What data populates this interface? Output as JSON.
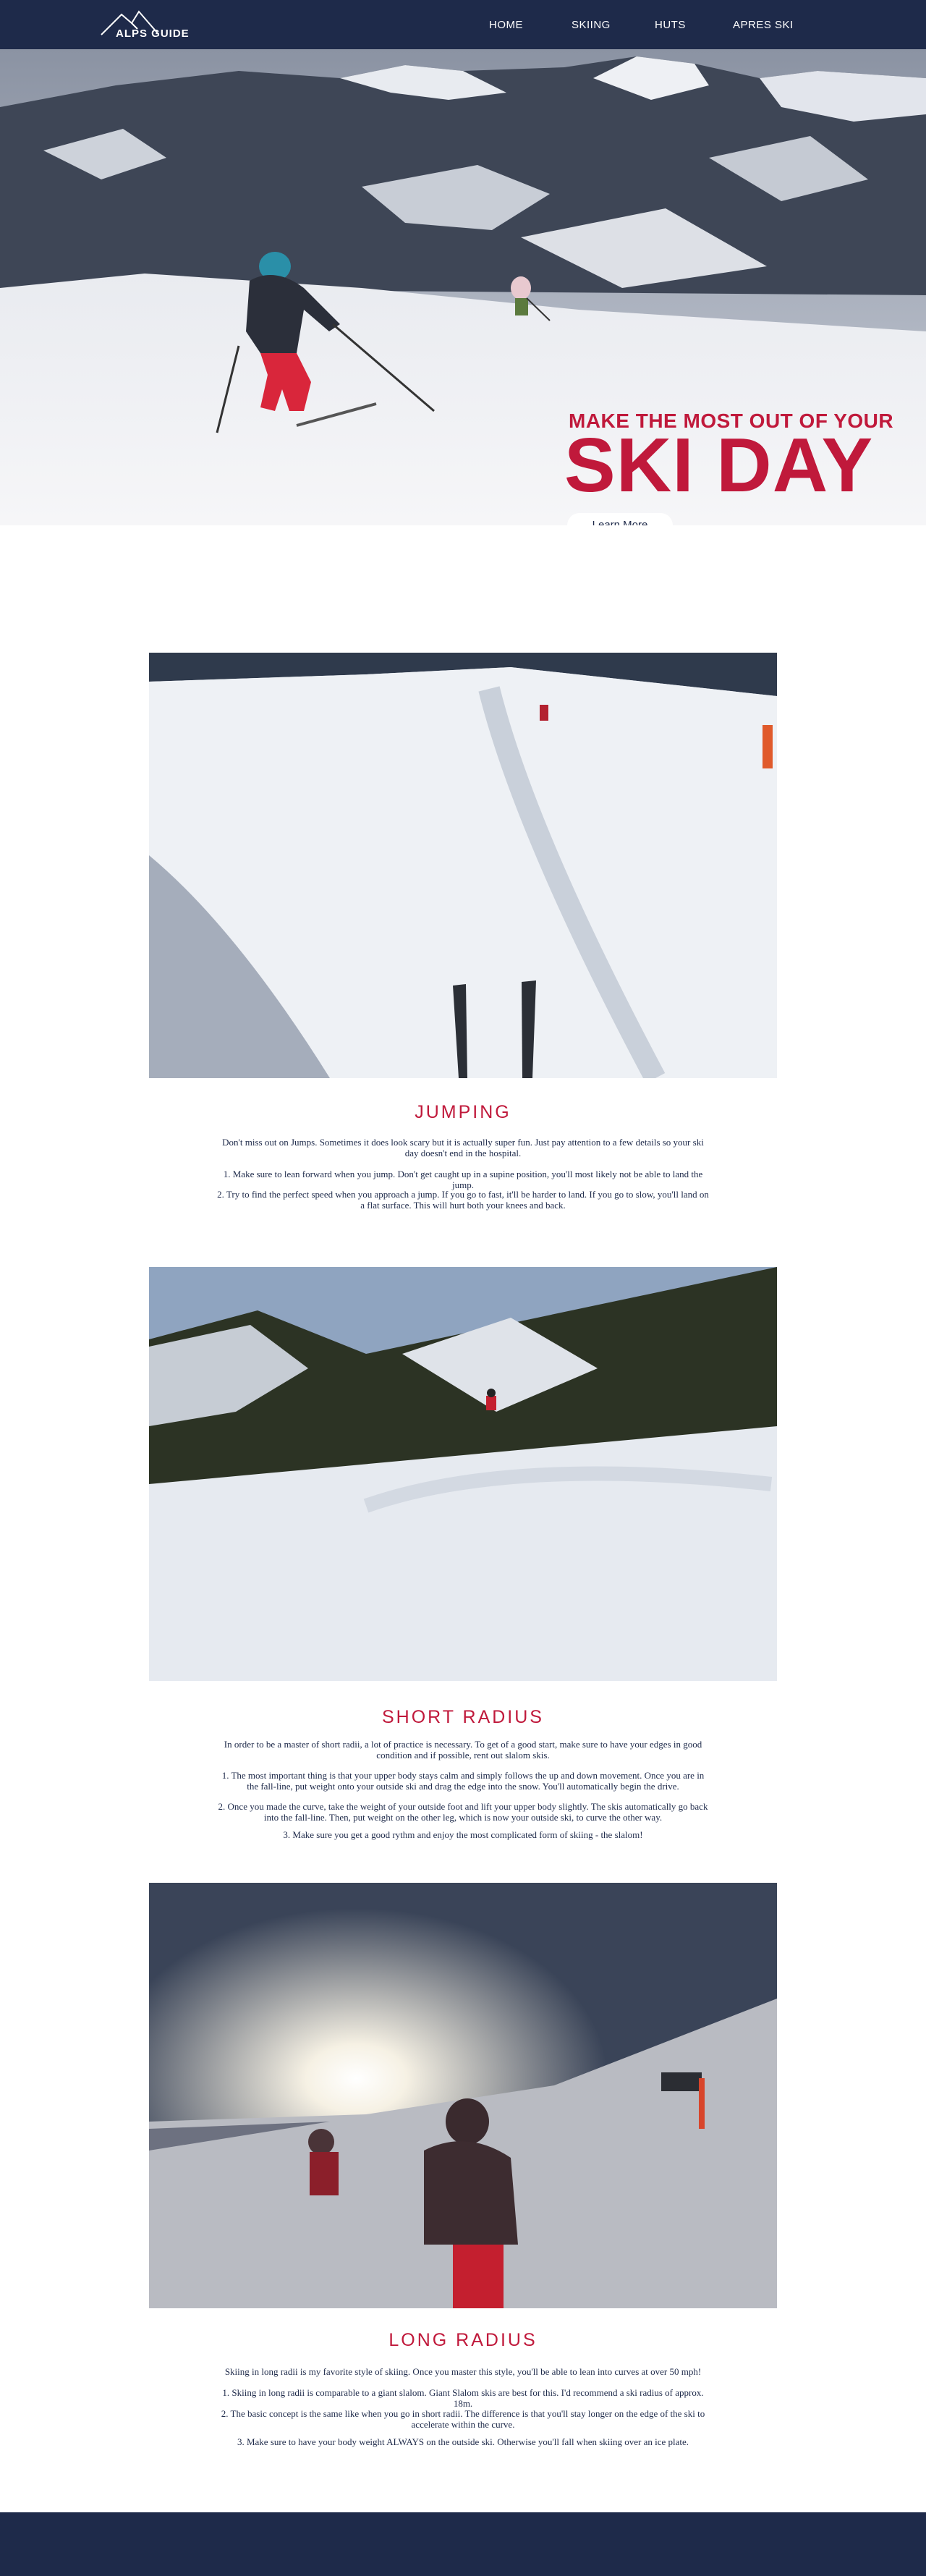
{
  "nav": {
    "logo_text": "ALPS GUIDE",
    "links": [
      "HOME",
      "SKIING",
      "HUTS",
      "APRES SKI"
    ]
  },
  "hero": {
    "subtitle": "MAKE THE MOST OUT OF YOUR",
    "title": "SKI DAY",
    "button": "Learn More"
  },
  "sections": [
    {
      "title": "JUMPING",
      "paragraphs": [
        "Don't miss out on Jumps. Sometimes it does look scary but it is actually super fun. Just pay attention to a few details so your ski day doesn't end in the hospital.",
        "1. Make sure to lean forward when you jump. Don't get caught up in a supine position, you'll most likely not be able to land the jump.",
        "2. Try to find the perfect speed when you approach a jump. If you go to fast, it'll be harder to land. If you go to slow, you'll land on a flat surface. This will hurt both your knees and back."
      ]
    },
    {
      "title": "SHORT RADIUS",
      "paragraphs": [
        "In order to be a master of short radii, a lot of practice is necessary. To get of a good start, make sure to have your edges in good condition and if possible, rent out slalom skis.",
        "1. The most important thing is that your upper body stays calm and simply follows the up and down movement. Once you are in the fall-line, put weight onto your outside ski and drag the edge into the snow. You'll automatically begin the drive.",
        "2. Once you made the curve, take the weight of your outside foot and lift your upper body slightly. The skis automatically go back into the fall-line. Then, put weight on the other leg, which is now your outside ski, to curve the other way.",
        "3. Make sure you get a good rythm and enjoy the most complicated form of skiing - the slalom!"
      ]
    },
    {
      "title": "LONG RADIUS",
      "paragraphs": [
        "Skiing in long radii is my favorite style of skiing. Once you master this style, you'll be able to lean into curves at over 50 mph!",
        "1. Skiing in long radii is comparable to a giant slalom. Giant Slalom skis are best for this. I'd recommend a ski radius of approx. 18m.",
        "2. The basic concept is the same like when you go in short radii. The difference is that you'll stay longer on the edge of the ski to accelerate within the curve.",
        "3. Make sure to have your body weight ALWAYS on the outside ski. Otherwise you'll fall when skiing over an ice plate."
      ]
    }
  ]
}
